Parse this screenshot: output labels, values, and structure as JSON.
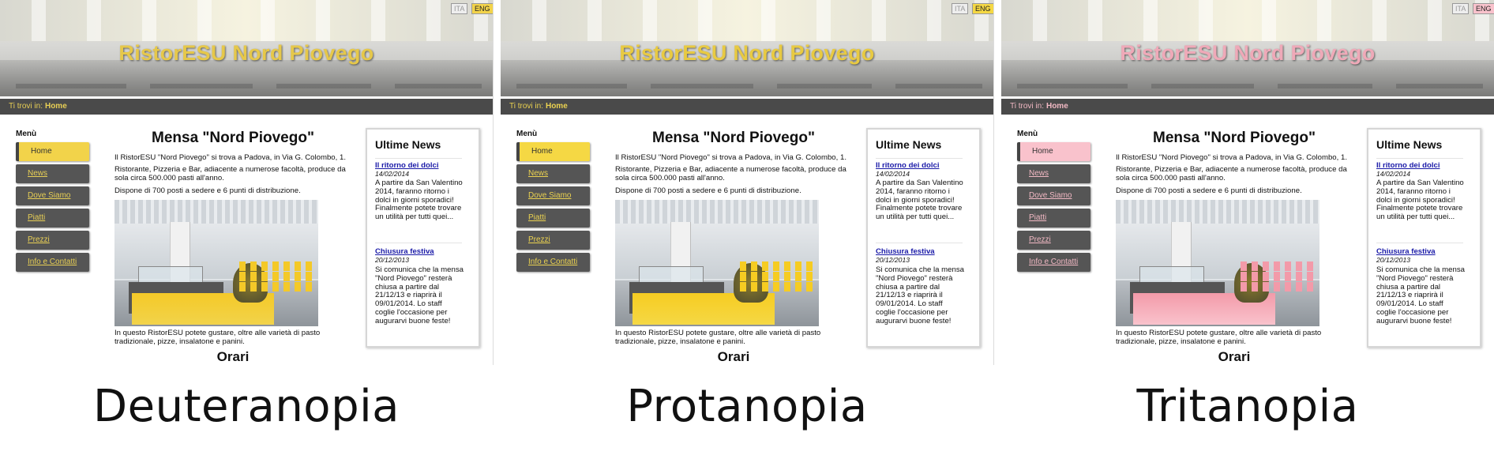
{
  "panels": [
    {
      "site_title": "RistorESU Nord Piovego",
      "lang": [
        "ITA",
        "ENG"
      ],
      "breadcrumb_prefix": "Ti trovi in:",
      "breadcrumb_current": "Home",
      "menu_title": "Menù",
      "menu": [
        "Home",
        "News",
        "Dove Siamo",
        "Piatti",
        "Prezzi",
        "Info e Contatti"
      ],
      "main_title": "Mensa \"Nord Piovego\"",
      "intro": "Il RistorESU \"Nord Piovego\" si trova a Padova, in Via G. Colombo, 1.",
      "description": "Ristorante, Pizzeria e Bar, adiacente a numerose facoltà, produce da sola circa 500.000 pasti all'anno.",
      "capacity": "Dispone di 700 posti a sedere e 6 punti di distribuzione.",
      "food_text": "In questo RistorESU potete gustare, oltre alle varietà di pasto tradizionale, pizze, insalatone e panini.",
      "orari_title": "Orari",
      "news_title": "Ultime News",
      "news": [
        {
          "title": "Il ritorno dei dolci",
          "date": "14/02/2014",
          "text": "A partire da San Valentino 2014, faranno ritorno i dolci in giorni sporadici! Finalmente potete trovare un utilità per tutti quei..."
        },
        {
          "title": "Chiusura festiva",
          "date": "20/12/2013",
          "text": "Si comunica che la mensa \"Nord Piovego\" resterà chiusa a partire dal 21/12/13 e riaprirà il 09/01/2014. Lo staff coglie l'occasione per augurarvi buone feste!"
        }
      ],
      "caption": "Deuteranopia",
      "colors": {
        "accent": "#f2d34a",
        "accent_text": "#e8cf55",
        "title_text": "#e6c84a",
        "banner_tint": "#e9e2b8",
        "photo_accent": "#f4c928"
      }
    },
    {
      "site_title": "RistorESU Nord Piovego",
      "lang": [
        "ITA",
        "ENG"
      ],
      "breadcrumb_prefix": "Ti trovi in:",
      "breadcrumb_current": "Home",
      "menu_title": "Menù",
      "menu": [
        "Home",
        "News",
        "Dove Siamo",
        "Piatti",
        "Prezzi",
        "Info e Contatti"
      ],
      "main_title": "Mensa \"Nord Piovego\"",
      "intro": "Il RistorESU \"Nord Piovego\" si trova a Padova, in Via G. Colombo, 1.",
      "description": "Ristorante, Pizzeria e Bar, adiacente a numerose facoltà, produce da sola circa 500.000 pasti all'anno.",
      "capacity": "Dispone di 700 posti a sedere e 6 punti di distribuzione.",
      "food_text": "In questo RistorESU potete gustare, oltre alle varietà di pasto tradizionale, pizze, insalatone e panini.",
      "orari_title": "Orari",
      "news_title": "Ultime News",
      "news": [
        {
          "title": "Il ritorno dei dolci",
          "date": "14/02/2014",
          "text": "A partire da San Valentino 2014, faranno ritorno i dolci in giorni sporadici! Finalmente potete trovare un utilità per tutti quei..."
        },
        {
          "title": "Chiusura festiva",
          "date": "20/12/2013",
          "text": "Si comunica che la mensa \"Nord Piovego\" resterà chiusa a partire dal 21/12/13 e riaprirà il 09/01/2014. Lo staff coglie l'occasione per augurarvi buone feste!"
        }
      ],
      "caption": "Protanopia",
      "colors": {
        "accent": "#f5d844",
        "accent_text": "#ebd250",
        "title_text": "#e8ca42",
        "banner_tint": "#ebe4b9",
        "photo_accent": "#f6cc22"
      }
    },
    {
      "site_title": "RistorESU Nord Piovego",
      "lang": [
        "ITA",
        "ENG"
      ],
      "breadcrumb_prefix": "Ti trovi in:",
      "breadcrumb_current": "Home",
      "menu_title": "Menù",
      "menu": [
        "Home",
        "News",
        "Dove Siamo",
        "Piatti",
        "Prezzi",
        "Info e Contatti"
      ],
      "main_title": "Mensa \"Nord Piovego\"",
      "intro": "Il RistorESU \"Nord Piovego\" si trova a Padova, in Via G. Colombo, 1.",
      "description": "Ristorante, Pizzeria e Bar, adiacente a numerose facoltà, produce da sola circa 500.000 pasti all'anno.",
      "capacity": "Dispone di 700 posti a sedere e 6 punti di distribuzione.",
      "food_text": "In questo RistorESU potete gustare, oltre alle varietà di pasto tradizionale, pizze, insalatone e panini.",
      "orari_title": "Orari",
      "news_title": "Ultime News",
      "news": [
        {
          "title": "Il ritorno dei dolci",
          "date": "14/02/2014",
          "text": "A partire da San Valentino 2014, faranno ritorno i dolci in giorni sporadici! Finalmente potete trovare un utilità per tutti quei..."
        },
        {
          "title": "Chiusura festiva",
          "date": "20/12/2013",
          "text": "Si comunica che la mensa \"Nord Piovego\" resterà chiusa a partire dal 21/12/13 e riaprirà il 09/01/2014. Lo staff coglie l'occasione per augurarvi buone feste!"
        }
      ],
      "caption": "Tritanopia",
      "colors": {
        "accent": "#f9c2cc",
        "accent_text": "#f2b9c4",
        "title_text": "#efa9b8",
        "banner_tint": "#efdadf",
        "photo_accent": "#f39aa9"
      }
    }
  ]
}
